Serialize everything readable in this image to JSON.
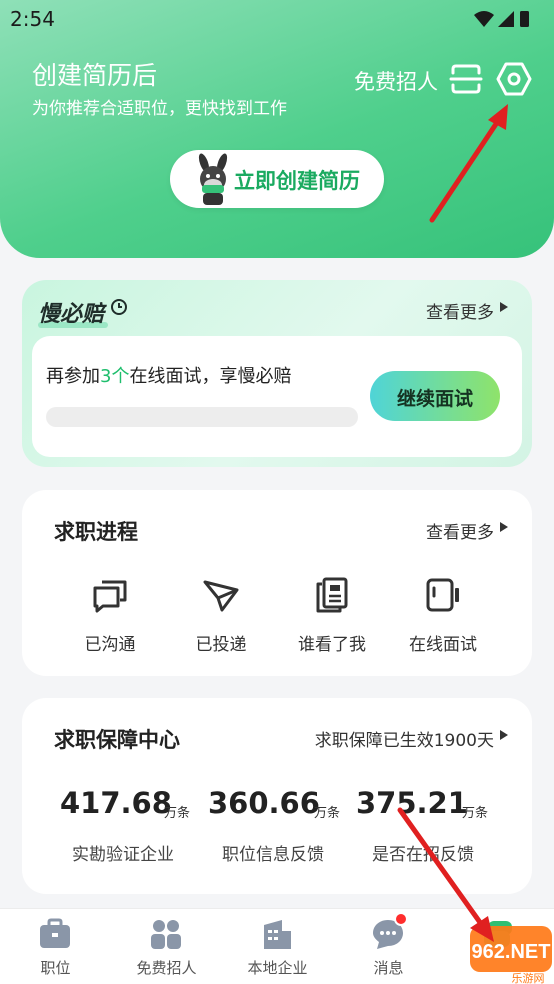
{
  "status_bar": {
    "time": "2:54"
  },
  "header": {
    "title": "创建简历后",
    "subtitle": "为你推荐合适职位，更快找到工作",
    "hire_label": "免费招人",
    "create_resume_label": "立即创建简历"
  },
  "guarantee_card": {
    "title": "慢必赔",
    "more_label": "查看更多",
    "text_before": "再参加",
    "count": "3个",
    "text_after": "在线面试，享慢必赔",
    "progress": 0,
    "button_label": "继续面试"
  },
  "progress_card": {
    "title": "求职进程",
    "more_label": "查看更多",
    "items": [
      {
        "label": "已沟通",
        "icon": "chat-icon"
      },
      {
        "label": "已投递",
        "icon": "send-icon"
      },
      {
        "label": "谁看了我",
        "icon": "document-icon"
      },
      {
        "label": "在线面试",
        "icon": "video-icon"
      }
    ]
  },
  "stats_card": {
    "title": "求职保障中心",
    "status_label": "求职保障已生效1900天",
    "stats": [
      {
        "value": "417.68",
        "unit": "万条",
        "label": "实勘验证企业"
      },
      {
        "value": "360.66",
        "unit": "万条",
        "label": "职位信息反馈"
      },
      {
        "value": "375.21",
        "unit": "万条",
        "label": "是否在招反馈"
      }
    ]
  },
  "bottom_nav": {
    "items": [
      {
        "label": "职位",
        "icon": "briefcase-icon"
      },
      {
        "label": "免费招人",
        "icon": "people-icon"
      },
      {
        "label": "本地企业",
        "icon": "building-icon"
      },
      {
        "label": "消息",
        "icon": "message-icon"
      },
      {
        "label": "",
        "icon": "profile-icon"
      }
    ]
  },
  "watermark": {
    "brand": "962.NET",
    "sub": "乐游网"
  },
  "colors": {
    "brand_green": "#36c27a",
    "highlight": "#1fbe6d",
    "badge_red": "#ff2d2d",
    "arrow_red": "#e02020"
  }
}
